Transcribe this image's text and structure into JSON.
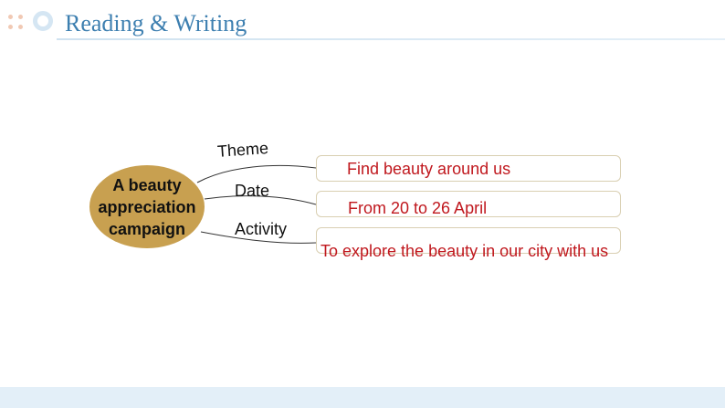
{
  "header": {
    "title": "Reading & Writing"
  },
  "diagram": {
    "center": {
      "text": "A beauty\nappreciation\ncampaign",
      "fill": "#c8a050"
    },
    "branches": [
      {
        "label": "Theme",
        "value": "Find beauty around us"
      },
      {
        "label": "Date",
        "value": "From 20 to 26 April"
      },
      {
        "label": "Activity",
        "value": "To explore the beauty in our city with us"
      }
    ],
    "value_color": "#c0181e",
    "box_border_color": "#d9cfb2"
  },
  "colors": {
    "title": "#3d7fb0",
    "accent_light": "#d5e6f3",
    "footer_band": "#e3eff8"
  }
}
